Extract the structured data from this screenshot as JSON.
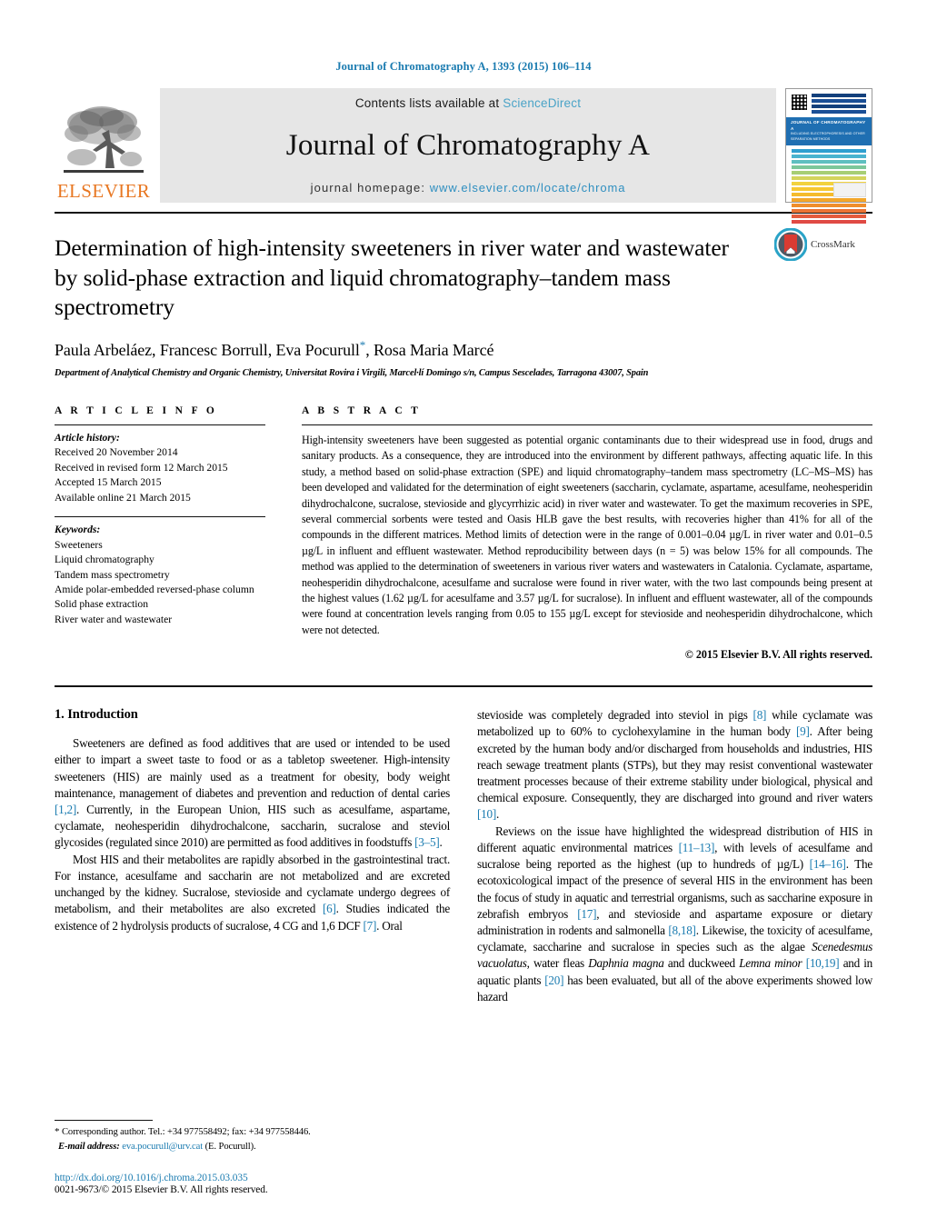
{
  "running_head": "Journal of Chromatography A, 1393 (2015) 106–114",
  "masthead": {
    "publisher_wordmark": "ELSEVIER",
    "contents_prefix": "Contents lists available at ",
    "contents_link": "ScienceDirect",
    "journal_title": "Journal of Chromatography A",
    "homepage_prefix": "journal homepage: ",
    "homepage_link": "www.elsevier.com/locate/chroma",
    "cover_band_title": "JOURNAL OF CHROMATOGRAPHY A",
    "cover_band_sub": "INCLUDING ELECTROPHORESIS AND OTHER SEPARATION METHODS"
  },
  "crossmark": {
    "label": "CrossMark"
  },
  "article": {
    "title": "Determination of high-intensity sweeteners in river water and wastewater by solid-phase extraction and liquid chromatography–tandem mass spectrometry",
    "authors": "Paula Arbeláez, Francesc Borrull, Eva Pocurull",
    "authors_tail": ", Rosa Maria Marcé",
    "corresponding_marker": "*",
    "affiliation": "Department of Analytical Chemistry and Organic Chemistry, Universitat Rovira i Virgili, Marcel·lí Domingo s/n, Campus Sescelades, Tarragona 43007, Spain"
  },
  "article_info": {
    "heading": "A R T I C L E   I N F O",
    "history_label": "Article history:",
    "history": [
      "Received 20 November 2014",
      "Received in revised form 12 March 2015",
      "Accepted 15 March 2015",
      "Available online 21 March 2015"
    ],
    "keywords_label": "Keywords:",
    "keywords": [
      "Sweeteners",
      "Liquid chromatography",
      "Tandem mass spectrometry",
      "Amide polar-embedded reversed-phase column",
      "Solid phase extraction",
      "River water and wastewater"
    ]
  },
  "abstract": {
    "heading": "A B S T R A C T",
    "text": "High-intensity sweeteners have been suggested as potential organic contaminants due to their widespread use in food, drugs and sanitary products. As a consequence, they are introduced into the environment by different pathways, affecting aquatic life. In this study, a method based on solid-phase extraction (SPE) and liquid chromatography–tandem mass spectrometry (LC–MS–MS) has been developed and validated for the determination of eight sweeteners (saccharin, cyclamate, aspartame, acesulfame, neohesperidin dihydrochalcone, sucralose, stevioside and glycyrrhizic acid) in river water and wastewater. To get the maximum recoveries in SPE, several commercial sorbents were tested and Oasis HLB gave the best results, with recoveries higher than 41% for all of the compounds in the different matrices. Method limits of detection were in the range of 0.001–0.04 µg/L in river water and 0.01–0.5 µg/L in influent and effluent wastewater. Method reproducibility between days (n = 5) was below 15% for all compounds. The method was applied to the determination of sweeteners in various river waters and wastewaters in Catalonia. Cyclamate, aspartame, neohesperidin dihydrochalcone, acesulfame and sucralose were found in river water, with the two last compounds being present at the highest values (1.62 µg/L for acesulfame and 3.57 µg/L for sucralose). In influent and effluent wastewater, all of the compounds were found at concentration levels ranging from 0.05 to 155 µg/L except for stevioside and neohesperidin dihydrochalcone, which were not detected.",
    "copyright": "© 2015 Elsevier B.V. All rights reserved."
  },
  "introduction": {
    "heading": "1.  Introduction",
    "left_paragraphs": [
      {
        "parts": [
          {
            "t": "Sweeteners are defined as food additives that are used or intended to be used either to impart a sweet taste to food or as a tabletop sweetener. High-intensity sweeteners (HIS) are mainly used as a treatment for obesity, body weight maintenance, management of diabetes and prevention and reduction of dental caries "
          },
          {
            "t": "[1,2]",
            "k": "ref"
          },
          {
            "t": ". Currently, in the European Union, HIS such as acesulfame, aspartame, cyclamate, neohesperidin dihydrochalcone, saccharin, sucralose and steviol glycosides (regulated since 2010) are permitted as food additives in foodstuffs "
          },
          {
            "t": "[3–5]",
            "k": "ref"
          },
          {
            "t": "."
          }
        ]
      },
      {
        "parts": [
          {
            "t": "Most HIS and their metabolites are rapidly absorbed in the gastrointestinal tract. For instance, acesulfame and saccharin are not metabolized and are excreted unchanged by the kidney. Sucralose, stevioside and cyclamate undergo degrees of metabolism, and their metabolites are also excreted "
          },
          {
            "t": "[6]",
            "k": "ref"
          },
          {
            "t": ". Studies indicated the existence of 2 hydrolysis products of sucralose, 4 CG and 1,6 DCF "
          },
          {
            "t": "[7]",
            "k": "ref"
          },
          {
            "t": ". Oral"
          }
        ]
      }
    ],
    "right_paragraphs": [
      {
        "parts": [
          {
            "t": "stevioside was completely degraded into steviol in pigs "
          },
          {
            "t": "[8]",
            "k": "ref"
          },
          {
            "t": " while cyclamate was metabolized up to 60% to cyclohexylamine in the human body "
          },
          {
            "t": "[9]",
            "k": "ref"
          },
          {
            "t": ". After being excreted by the human body and/or discharged from households and industries, HIS reach sewage treatment plants (STPs), but they may resist conventional wastewater treatment processes because of their extreme stability under biological, physical and chemical exposure. Consequently, they are discharged into ground and river waters "
          },
          {
            "t": "[10]",
            "k": "ref"
          },
          {
            "t": "."
          }
        ]
      },
      {
        "parts": [
          {
            "t": "Reviews on the issue have highlighted the widespread distribution of HIS in different aquatic environmental matrices "
          },
          {
            "t": "[11–13]",
            "k": "ref"
          },
          {
            "t": ", with levels of acesulfame and sucralose being reported as the highest (up to hundreds of µg/L) "
          },
          {
            "t": "[14–16]",
            "k": "ref"
          },
          {
            "t": ". The ecotoxicological impact of the presence of several HIS in the environment has been the focus of study in aquatic and terrestrial organisms, such as saccharine exposure in zebrafish embryos "
          },
          {
            "t": "[17]",
            "k": "ref"
          },
          {
            "t": ", and stevioside and aspartame exposure or dietary administration in rodents and salmonella "
          },
          {
            "t": "[8,18]",
            "k": "ref"
          },
          {
            "t": ". Likewise, the toxicity of acesulfame, cyclamate, saccharine and sucralose in species such as the algae "
          },
          {
            "t": "Scenedesmus vacuolatus",
            "k": "it"
          },
          {
            "t": ", water fleas "
          },
          {
            "t": "Daphnia magna",
            "k": "it"
          },
          {
            "t": " and duckweed "
          },
          {
            "t": "Lemna minor",
            "k": "it"
          },
          {
            "t": " "
          },
          {
            "t": "[10,19]",
            "k": "ref"
          },
          {
            "t": " and in aquatic plants "
          },
          {
            "t": "[20]",
            "k": "ref"
          },
          {
            "t": " has been evaluated, but all of the above experiments showed low hazard"
          }
        ]
      }
    ]
  },
  "footnotes": {
    "corresponding": "Corresponding author. Tel.: +34 977558492; fax: +34 977558446.",
    "email_label": "E-mail address:",
    "email": "eva.pocurull@urv.cat",
    "email_owner": "(E. Pocurull).",
    "doi": "http://dx.doi.org/10.1016/j.chroma.2015.03.035",
    "issn": "0021-9673/© 2015 Elsevier B.V. All rights reserved."
  },
  "colors": {
    "link_blue": "#1a7bb0",
    "elsevier_orange": "#E87722",
    "banner_gray": "#e6e6e6",
    "cover_band_blue": "#1f6fb2"
  }
}
